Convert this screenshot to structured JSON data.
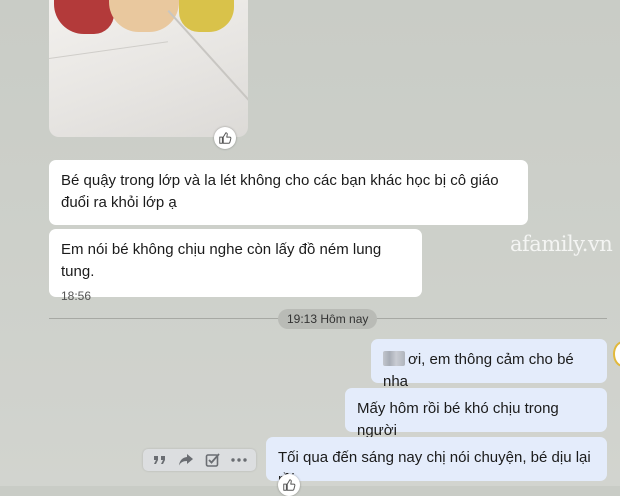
{
  "messages": {
    "m1": {
      "text": "Bé quậy trong lớp và la lét không cho các bạn khác học bị cô giáo đuổi ra khỏi lớp ạ"
    },
    "m2": {
      "text": "Em nói bé không chịu nghe còn lấy đồ ném lung tung.",
      "time": "18:56"
    },
    "m3": {
      "text": "ơi, em thông cảm cho bé nha"
    },
    "m4": {
      "text": "Mấy hôm rồi bé khó chịu trong người"
    },
    "m5": {
      "text": "Tối qua đến sáng nay chị nói chuyện, bé dịu lại rồi"
    }
  },
  "date_separator": "19:13 Hôm nay",
  "watermark": "afamily.vn",
  "icons": {
    "reaction": "thumbs-up-icon",
    "toolbar": [
      "quote-icon",
      "forward-icon",
      "add-task-icon",
      "more-icon"
    ]
  },
  "colors": {
    "incoming_bubble": "#ffffff",
    "outgoing_bubble": "#e4ecfb",
    "background": "#cdd0ca"
  }
}
